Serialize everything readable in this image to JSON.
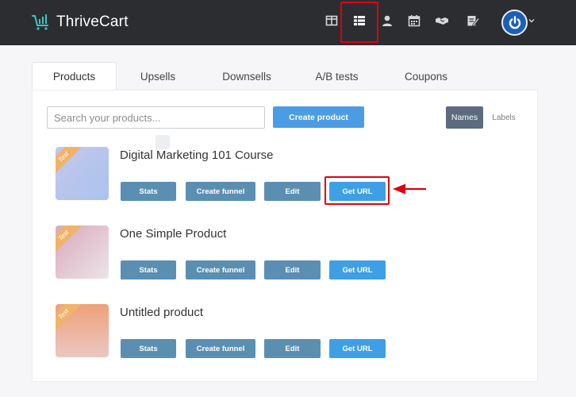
{
  "header": {
    "brand": "ThriveCart",
    "nav_icons": [
      "dashboard-icon",
      "products-list-icon",
      "customer-icon",
      "calendar-icon",
      "affiliates-icon",
      "notes-icon"
    ],
    "active_nav": "products-list-icon",
    "avatar_icon": "power-icon"
  },
  "tabs": [
    {
      "label": "Products",
      "active": true
    },
    {
      "label": "Upsells",
      "active": false
    },
    {
      "label": "Downsells",
      "active": false
    },
    {
      "label": "A/B tests",
      "active": false
    },
    {
      "label": "Coupons",
      "active": false
    }
  ],
  "toolbar": {
    "search_placeholder": "Search your products...",
    "create_label": "Create product",
    "toggle_names": "Names",
    "toggle_labels": "Labels"
  },
  "products": [
    {
      "title": "Digital Marketing 101 Course",
      "badge": "Test",
      "thumb_colors": [
        "#c7c6ea",
        "#a8c4ef"
      ]
    },
    {
      "title": "One Simple Product",
      "badge": "Test",
      "thumb_colors": [
        "#d9a9bb",
        "#ece4e8"
      ]
    },
    {
      "title": "Untitled product",
      "badge": "Test",
      "thumb_colors": [
        "#eea178",
        "#ebc7c3"
      ]
    }
  ],
  "product_actions": {
    "stats": "Stats",
    "funnel": "Create funnel",
    "edit": "Edit",
    "url": "Get URL"
  },
  "colors": {
    "header_bg": "#2b2d31",
    "primary_button": "#4c9ce3",
    "secondary_button": "#5b8fb2",
    "highlight": "#e0000f"
  }
}
